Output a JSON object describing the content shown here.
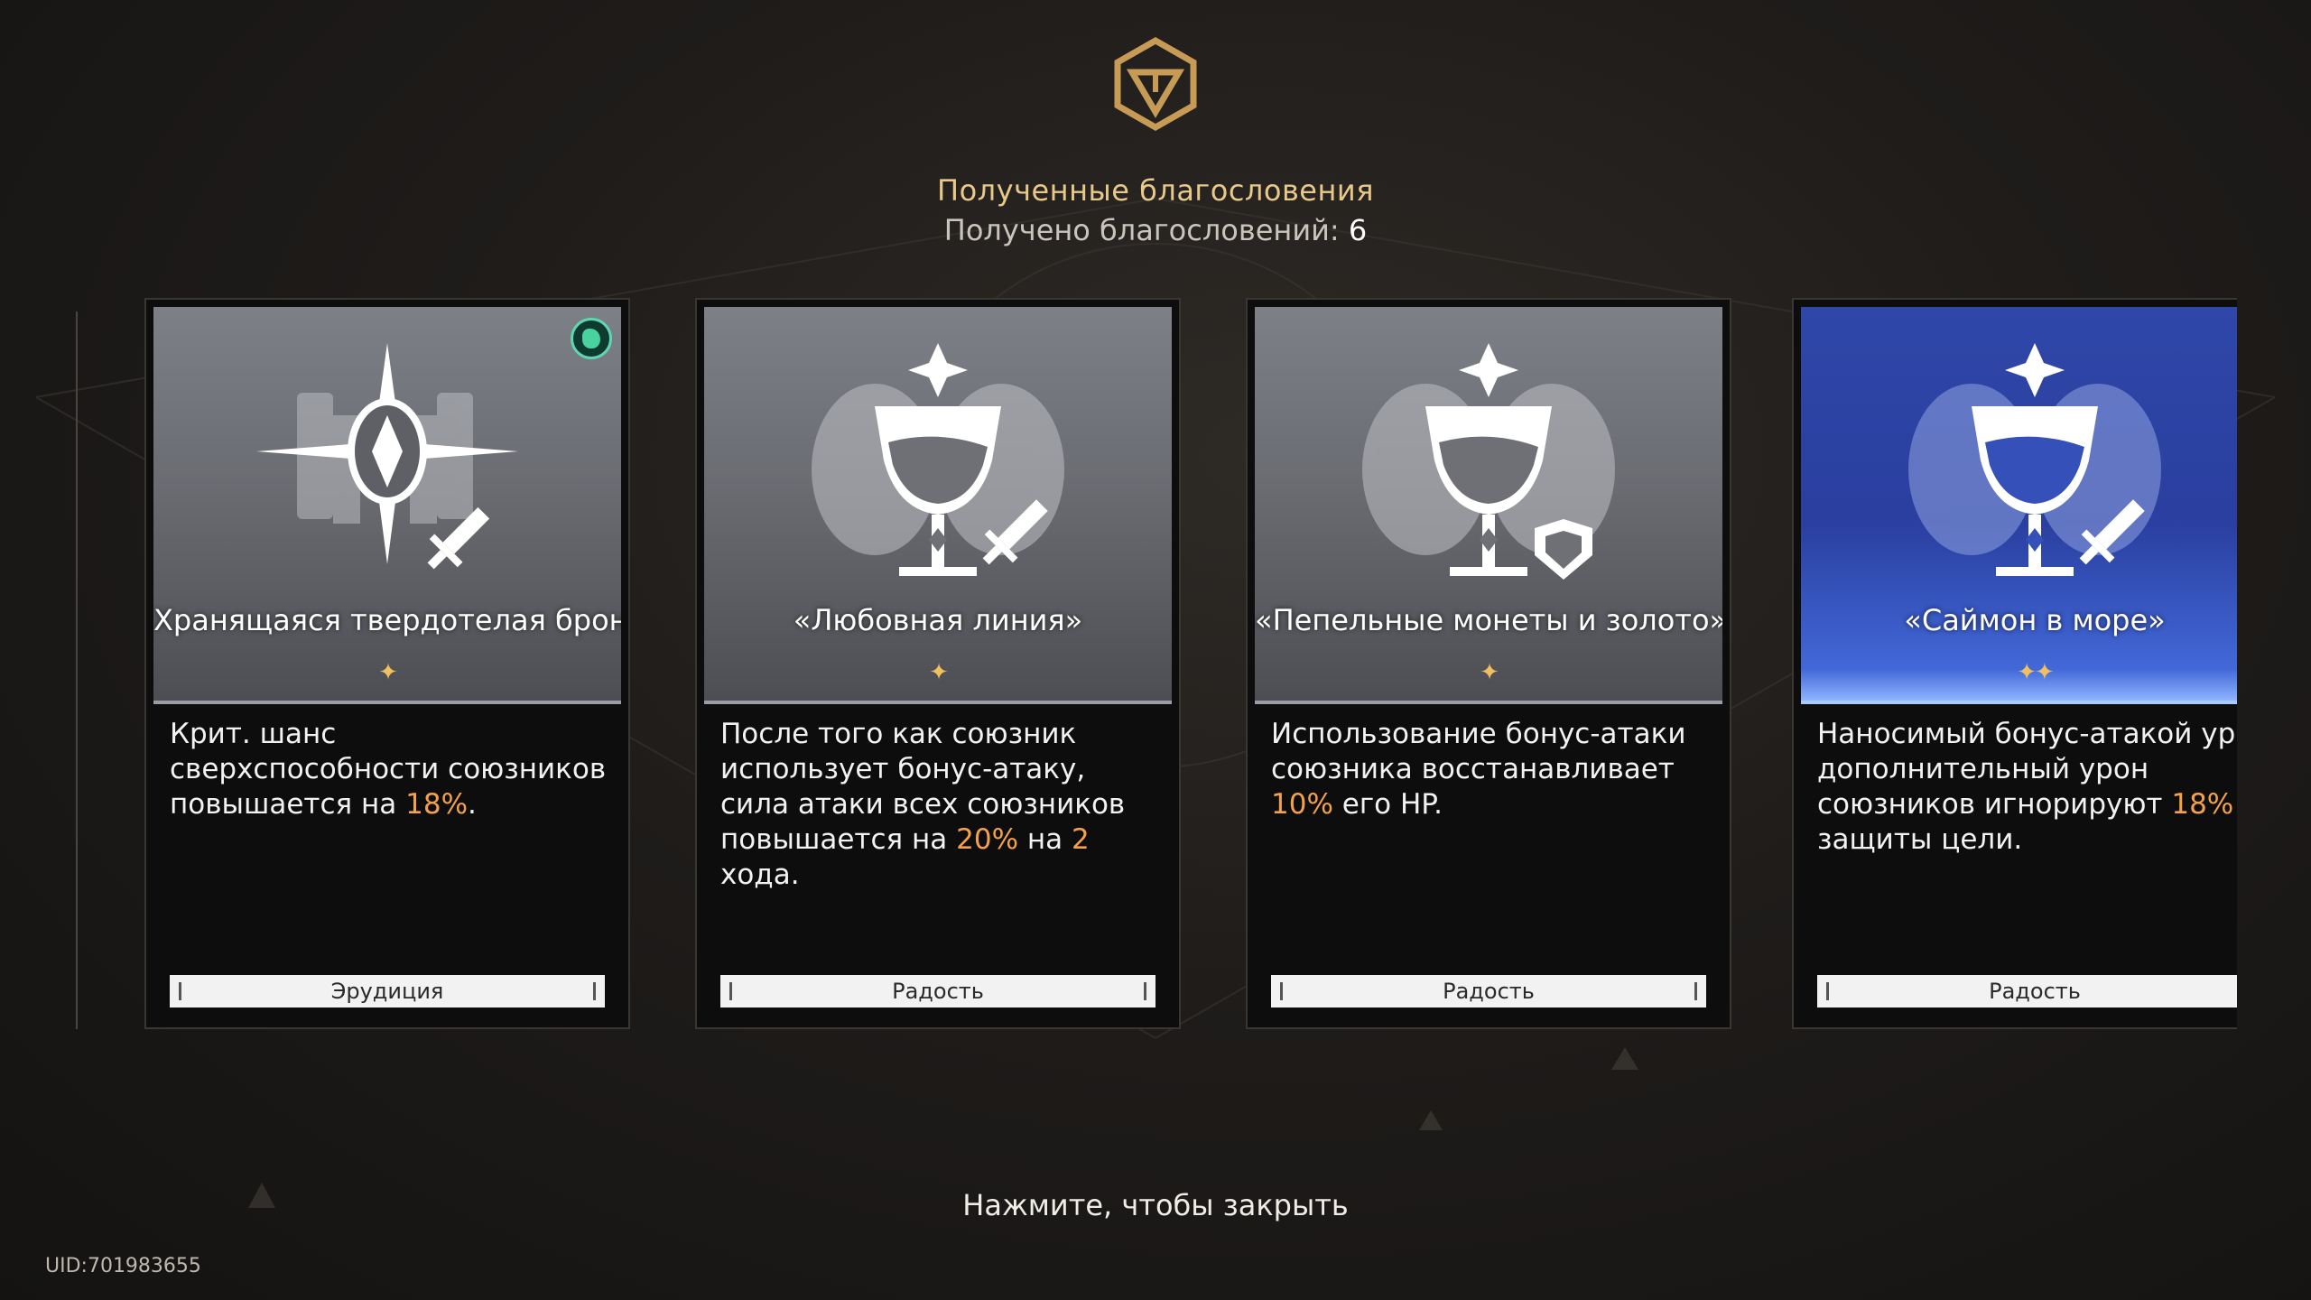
{
  "header": {
    "title": "Полученные благословения",
    "count_label": "Получено благословений: ",
    "count_value": "6"
  },
  "cards": [
    {
      "name": "Хранящаяся твердотелая броня",
      "stars": "✦",
      "desc": [
        "Крит. шанс сверхспособности союзников повышается на ",
        "18%",
        "."
      ],
      "tag": "Эрудиция",
      "icon": "erudition-shield-icon",
      "badge": "path-badge-icon"
    },
    {
      "name": "«Любовная линия»",
      "stars": "✦",
      "desc": [
        "После того как союзник использует бонус-атаку, сила атаки всех союзников повышается на ",
        "20%",
        " на ",
        "2",
        " хода."
      ],
      "tag": "Радость",
      "icon": "goblet-sword-icon"
    },
    {
      "name": "«Пепельные монеты и золото»",
      "stars": "✦",
      "desc": [
        "Использование бонус-атаки союзника восстанавливает ",
        "10%",
        " его HP."
      ],
      "tag": "Радость",
      "icon": "goblet-shield-icon"
    },
    {
      "name": "«Саймон в море»",
      "stars": "✦✦",
      "desc": [
        "Наносимый бонус-атакой урон и дополнительный урон союзников игнорируют ",
        "18%",
        " защиты цели."
      ],
      "tag": "Радость",
      "icon": "goblet-sword-icon"
    }
  ],
  "footer": {
    "close_hint": "Нажмите, чтобы закрыть",
    "uid": "UID:701983655"
  },
  "colors": {
    "accent_gold": "#e9c98a",
    "highlight_orange": "#f4a24a",
    "blue_card": "#2f47a8"
  }
}
